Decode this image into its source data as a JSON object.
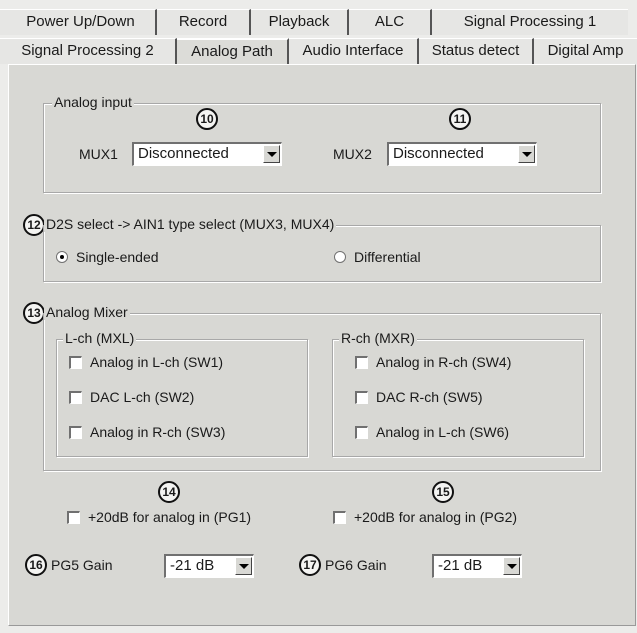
{
  "tabs_row1": [
    "Power Up/Down",
    "Record",
    "Playback",
    "ALC",
    "Signal Processing 1"
  ],
  "tabs_row2": [
    "Signal Processing 2",
    "Analog Path",
    "Audio Interface",
    "Status detect",
    "Digital Amp"
  ],
  "active_tab": "Analog Path",
  "analog_input": {
    "legend": "Analog input",
    "mux1_label": "MUX1",
    "mux1_value": "Disconnected",
    "mux2_label": "MUX2",
    "mux2_value": "Disconnected"
  },
  "d2s": {
    "legend": "D2S select -> AIN1 type select (MUX3, MUX4)",
    "single_label": "Single-ended",
    "single_selected": true,
    "diff_label": "Differential",
    "diff_selected": false
  },
  "mixer": {
    "legend": "Analog Mixer",
    "lch_legend": "L-ch (MXL)",
    "rch_legend": "R-ch (MXR)",
    "lch_items": [
      "Analog in L-ch (SW1)",
      "DAC L-ch (SW2)",
      "Analog in R-ch (SW3)"
    ],
    "rch_items": [
      "Analog in R-ch (SW4)",
      "DAC R-ch (SW5)",
      "Analog in L-ch (SW6)"
    ]
  },
  "pg1_label": "+20dB for analog in (PG1)",
  "pg2_label": "+20dB for analog in (PG2)",
  "pg5": {
    "label": "PG5 Gain",
    "value": "-21 dB"
  },
  "pg6": {
    "label": "PG6 Gain",
    "value": "-21 dB"
  },
  "callouts": {
    "c10": "10",
    "c11": "11",
    "c12": "12",
    "c13": "13",
    "c14": "14",
    "c15": "15",
    "c16": "16",
    "c17": "17"
  }
}
